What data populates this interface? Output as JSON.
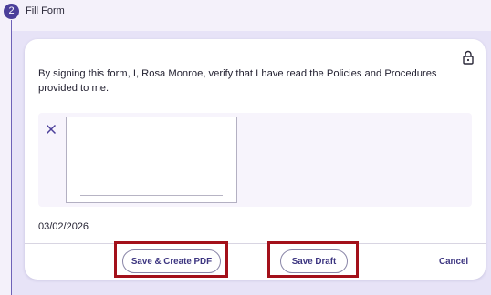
{
  "step": {
    "number": "2",
    "title": "Fill Form"
  },
  "form": {
    "statement": "By signing this form, I, Rosa Monroe, verify that I have read the Policies and Procedures provided to me.",
    "date": "03/02/2026"
  },
  "actions": {
    "save_create_pdf": "Save & Create PDF",
    "save_draft": "Save Draft",
    "cancel": "Cancel"
  },
  "icons": {
    "lock": "lock-icon",
    "clear": "close-icon"
  },
  "colors": {
    "accent": "#4b3f9a",
    "button_text": "#3c3580",
    "highlight": "#a3101a",
    "panel_background": "#e7e3f7"
  }
}
